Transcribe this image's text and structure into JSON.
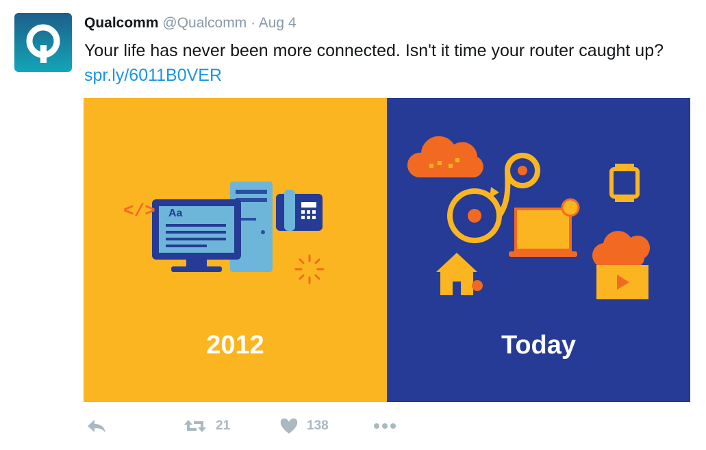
{
  "tweet": {
    "author_name": "Qualcomm",
    "handle": "@Qualcomm",
    "separator": "·",
    "date": "Aug 4",
    "text": "Your life has never been more connected. Isn't it time your router caught up?",
    "link": "spr.ly/6011B0VER"
  },
  "media": {
    "left_label": "2012",
    "right_label": "Today",
    "left_color": "#fbb520",
    "right_color": "#253b95",
    "code_tag": "</>",
    "screen_text": "Aa"
  },
  "actions": {
    "retweet_count": "21",
    "like_count": "138"
  },
  "colors": {
    "link": "#1b95e0",
    "muted": "#8899a6",
    "action": "#aab8c2"
  }
}
